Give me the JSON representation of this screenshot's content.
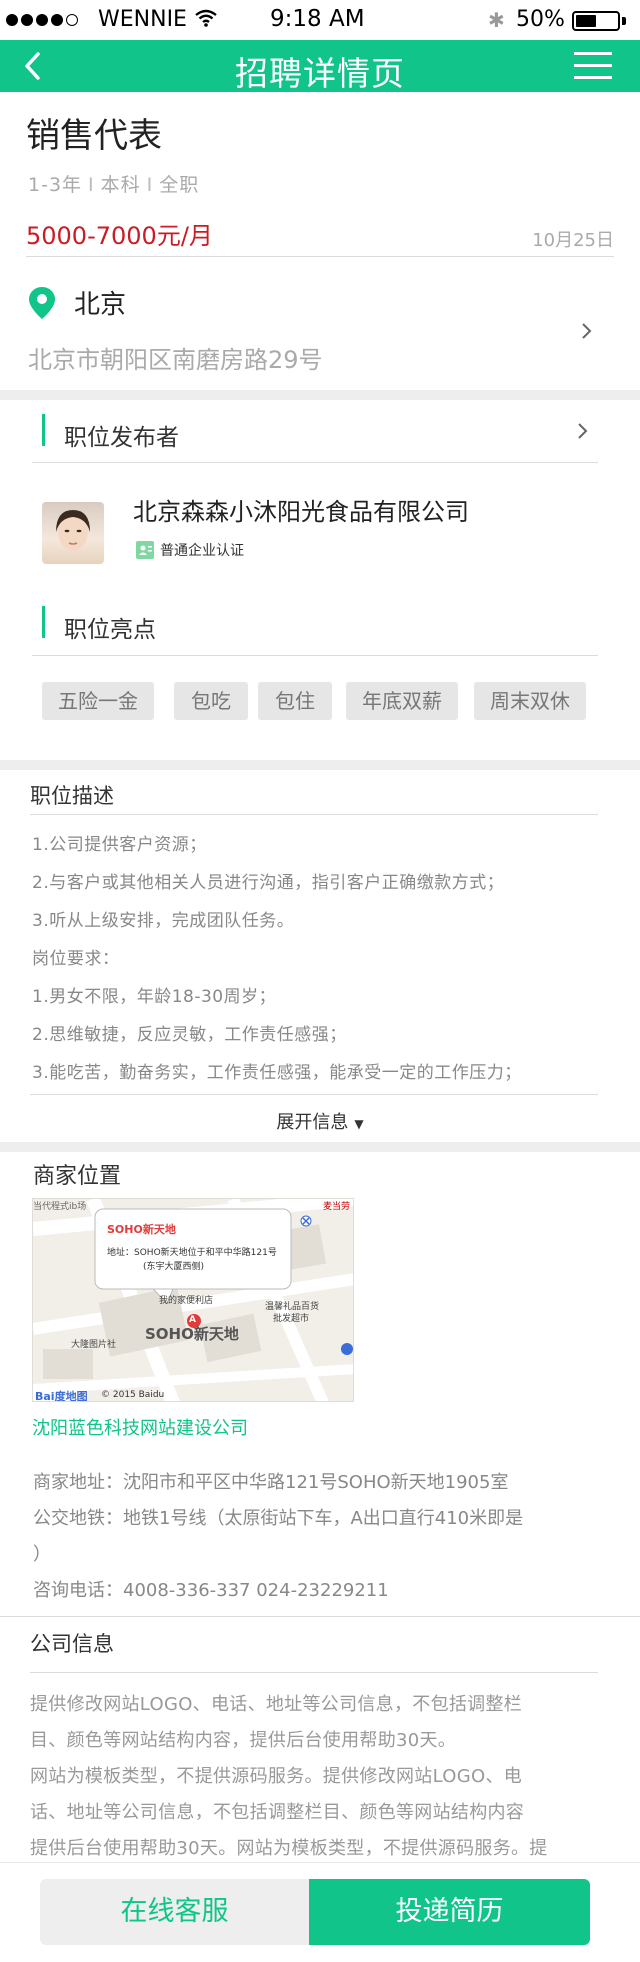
{
  "status_bar": {
    "carrier": "WENNIE",
    "time": "9:18 AM",
    "battery": "50%",
    "battery_level": 0.5
  },
  "nav": {
    "title": "招聘详情页",
    "back_icon": "chevron-left-icon",
    "menu_icon": "hamburger-menu-icon"
  },
  "job": {
    "title": "销售代表",
    "experience": "1-3年",
    "education": "本科",
    "type": "全职",
    "meta_separator": "I",
    "salary": "5000-7000元/月",
    "date": "10月25日",
    "city": "北京",
    "address": "北京市朝阳区南磨房路29号"
  },
  "publisher": {
    "heading": "职位发布者",
    "company": "北京森森小沐阳光食品有限公司",
    "verification": "普通企业认证"
  },
  "highlights": {
    "heading": "职位亮点",
    "tags": [
      "五险一金",
      "包吃",
      "包住",
      "年底双薪",
      "周末双休"
    ]
  },
  "description": {
    "heading": "职位描述",
    "lines": [
      "1.公司提供客户资源；",
      "2.与客户或其他相关人员进行沟通，指引客户正确缴款方式；",
      "3.听从上级安排，完成团队任务。",
      "岗位要求：",
      "1.男女不限，年龄18-30周岁；",
      "2.思维敏捷，反应灵敏，工作责任感强；",
      "3.能吃苦，勤奋务实，工作责任感强，能承受一定的工作压力；"
    ],
    "expand_label": "展开信息",
    "expand_caret": "▼"
  },
  "location": {
    "heading": "商家位置",
    "map": {
      "popup_title": "SOHO新天地",
      "popup_address": "地址：SOHO新天地位于和平中华路121号",
      "popup_address_2": "(东宇大厦西侧)",
      "landmark": "SOHO新天地",
      "poi_1": "当代程式ib场",
      "poi_2": "我的家便利店",
      "poi_3": "温馨礼品百货",
      "poi_4": "批发超市",
      "poi_5": "大隆图片社",
      "poi_6": "麦当劳",
      "marker": "A",
      "copyright": "© 2015 Baidu",
      "logo": "Bai度地图"
    },
    "company_link": "沈阳蓝色科技网站建设公司",
    "address_line": "商家地址：沈阳市和平区中华路121号SOHO新天地1905室",
    "transit_line_1": "公交地铁：地铁1号线（太原街站下车，A出口直行410米即是",
    "transit_line_2": "）",
    "phone_line": "咨询电话：4008-336-337 024-23229211"
  },
  "company_info": {
    "heading": "公司信息",
    "lines": [
      "提供修改网站LOGO、电话、地址等公司信息，不包括调整栏",
      "目、颜色等网站结构内容，提供后台使用帮助30天。",
      "网站为模板类型，不提供源码服务。提供修改网站LOGO、电",
      "话、地址等公司信息，不包括调整栏目、颜色等网站结构内容",
      "提供后台使用帮助30天。网站为模板类型，不提供源码服务。提"
    ]
  },
  "actions": {
    "service_label": "在线客服",
    "apply_label": "投递简历"
  },
  "colors": {
    "accent": "#10c48a",
    "salary": "#c81d25"
  }
}
